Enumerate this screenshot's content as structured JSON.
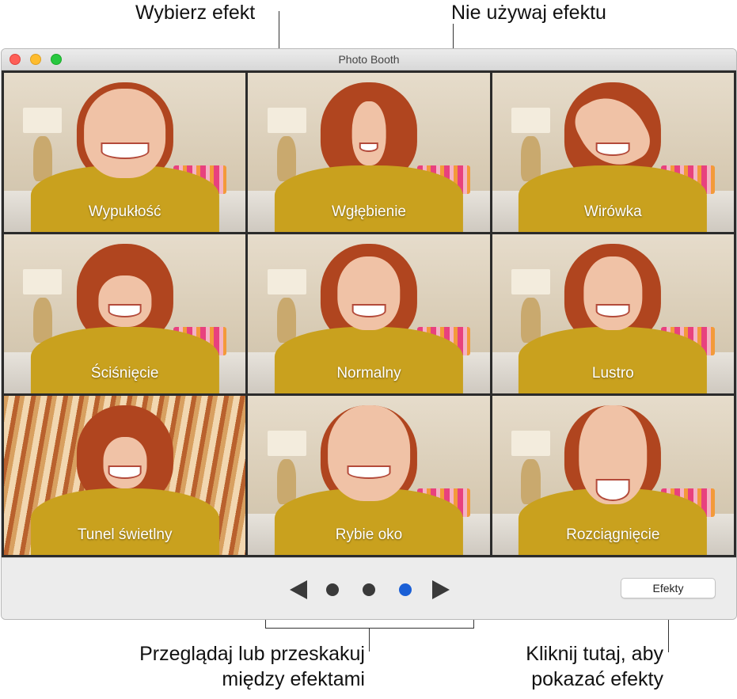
{
  "callouts": {
    "choose_effect": "Wybierz efekt",
    "no_effect": "Nie używaj efektu",
    "browse": [
      "Przeglądaj lub przeskakuj",
      "między efektami"
    ],
    "click_here": [
      "Kliknij tutaj, aby",
      "pokazać efekty"
    ]
  },
  "window": {
    "title": "Photo Booth"
  },
  "effects": [
    {
      "label": "Wypukłość",
      "icon": "bulge-effect-photo"
    },
    {
      "label": "Wgłębienie",
      "icon": "dent-effect-photo"
    },
    {
      "label": "Wirówka",
      "icon": "twirl-effect-photo"
    },
    {
      "label": "Ściśnięcie",
      "icon": "squeeze-effect-photo"
    },
    {
      "label": "Normalny",
      "icon": "normal-photo"
    },
    {
      "label": "Lustro",
      "icon": "mirror-effect-photo"
    },
    {
      "label": "Tunel świetlny",
      "icon": "light-tunnel-effect-photo"
    },
    {
      "label": "Rybie oko",
      "icon": "fisheye-effect-photo"
    },
    {
      "label": "Rozciągnięcie",
      "icon": "stretch-effect-photo"
    }
  ],
  "pagination": {
    "pages": 3,
    "current_page": 3,
    "active_color": "#1a5fd6",
    "inactive_color": "#3a3a3a"
  },
  "toolbar": {
    "effects_label": "Efekty"
  }
}
